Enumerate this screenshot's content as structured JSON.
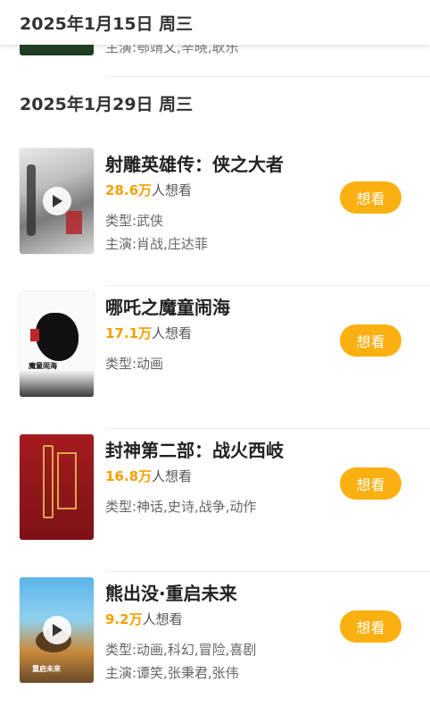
{
  "sticky_header": {
    "date": "2025年1月15日 周三"
  },
  "previous_item": {
    "cast": "主演:鄂靖文,辛晓,耿乐"
  },
  "section": {
    "date": "2025年1月29日 周三"
  },
  "colors": {
    "accent": "#fbb012",
    "count": "#f5a000"
  },
  "movies": [
    {
      "title": "射雕英雄传：侠之大者",
      "want_count": "28.6万",
      "want_suffix": "人想看",
      "genre": "类型:武侠",
      "cast": "主演:肖战,庄达菲",
      "has_trailer": true,
      "button": "想看",
      "poster_caption": ""
    },
    {
      "title": "哪吒之魔童闹海",
      "want_count": "17.1万",
      "want_suffix": "人想看",
      "genre": "类型:动画",
      "cast": "",
      "has_trailer": false,
      "button": "想看",
      "poster_caption": "魔童闹海"
    },
    {
      "title": "封神第二部：战火西岐",
      "want_count": "16.8万",
      "want_suffix": "人想看",
      "genre": "类型:神话,史诗,战争,动作",
      "cast": "",
      "has_trailer": false,
      "button": "想看",
      "poster_caption": ""
    },
    {
      "title": "熊出没·重启未来",
      "want_count": "9.2万",
      "want_suffix": "人想看",
      "genre": "类型:动画,科幻,冒险,喜剧",
      "cast": "主演:谭笑,张秉君,张伟",
      "has_trailer": true,
      "button": "想看",
      "poster_caption": "重启未来"
    }
  ]
}
